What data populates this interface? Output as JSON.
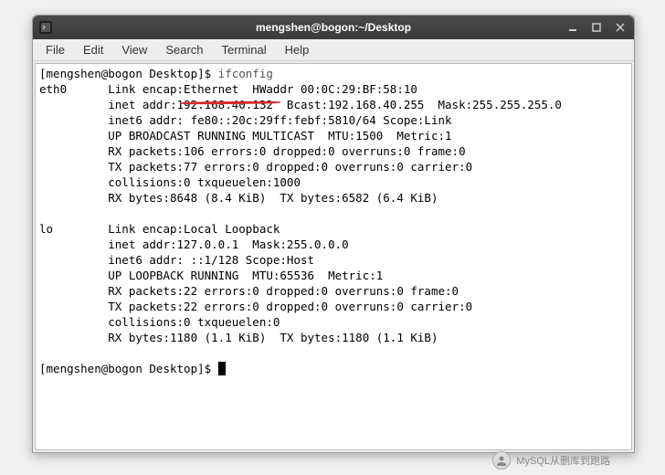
{
  "window": {
    "title": "mengshen@bogon:~/Desktop"
  },
  "menu": {
    "file": "File",
    "edit": "Edit",
    "view": "View",
    "search": "Search",
    "terminal": "Terminal",
    "help": "Help"
  },
  "terminal": {
    "prompt1": "[mengshen@bogon Desktop]$ ",
    "cmd1": "ifconfig",
    "eth0_l1": "eth0      Link encap:Ethernet  HWaddr 00:0C:29:BF:58:10",
    "eth0_l2": "          inet addr:192.168.40.132  Bcast:192.168.40.255  Mask:255.255.255.0",
    "eth0_l3": "          inet6 addr: fe80::20c:29ff:febf:5810/64 Scope:Link",
    "eth0_l4": "          UP BROADCAST RUNNING MULTICAST  MTU:1500  Metric:1",
    "eth0_l5": "          RX packets:106 errors:0 dropped:0 overruns:0 frame:0",
    "eth0_l6": "          TX packets:77 errors:0 dropped:0 overruns:0 carrier:0",
    "eth0_l7": "          collisions:0 txqueuelen:1000",
    "eth0_l8": "          RX bytes:8648 (8.4 KiB)  TX bytes:6582 (6.4 KiB)",
    "blank": "",
    "lo_l1": "lo        Link encap:Local Loopback",
    "lo_l2": "          inet addr:127.0.0.1  Mask:255.0.0.0",
    "lo_l3": "          inet6 addr: ::1/128 Scope:Host",
    "lo_l4": "          UP LOOPBACK RUNNING  MTU:65536  Metric:1",
    "lo_l5": "          RX packets:22 errors:0 dropped:0 overruns:0 frame:0",
    "lo_l6": "          TX packets:22 errors:0 dropped:0 overruns:0 carrier:0",
    "lo_l7": "          collisions:0 txqueuelen:0",
    "lo_l8": "          RX bytes:1180 (1.1 KiB)  TX bytes:1180 (1.1 KiB)",
    "prompt2": "[mengshen@bogon Desktop]$ "
  },
  "watermark": {
    "text": "MySQL从删库到跑路"
  },
  "highlighted_ip": "192.168.40.132"
}
